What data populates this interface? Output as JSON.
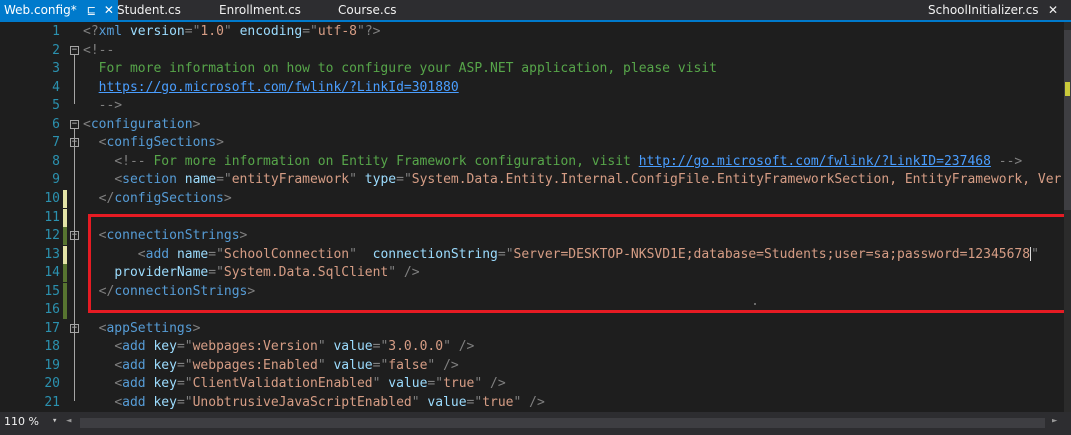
{
  "tabs": [
    {
      "label": "Web.config*",
      "active": true,
      "pin_icon": "pin-icon",
      "close_icon": "close-icon"
    },
    {
      "label": "Student.cs"
    },
    {
      "label": "Enrollment.cs"
    },
    {
      "label": "Course.cs"
    },
    {
      "label": "SchoolInitializer.cs",
      "close_icon": "close-icon"
    }
  ],
  "symbols": {
    "pin": "⊑",
    "close": "✕",
    "fold_open": "−",
    "dropdown": "▾",
    "left": "◄",
    "right": "►"
  },
  "colors": {
    "accent": "#007acc",
    "tag": "#569cd6",
    "attr": "#9cdcfe",
    "string": "#d69d85",
    "comment": "#57a64a",
    "line_number": "#2b91af",
    "highlight_box": "#e51b23"
  },
  "editor": {
    "lines": [
      {
        "num": "1",
        "tokens": [
          [
            "delim",
            "<?"
          ],
          [
            "tag",
            "xml"
          ],
          [
            "text",
            " "
          ],
          [
            "attr",
            "version"
          ],
          [
            "delim",
            "="
          ],
          [
            "delim",
            "\""
          ],
          [
            "str",
            "1.0"
          ],
          [
            "delim",
            "\""
          ],
          [
            "text",
            " "
          ],
          [
            "attr",
            "encoding"
          ],
          [
            "delim",
            "="
          ],
          [
            "delim",
            "\""
          ],
          [
            "str",
            "utf-8"
          ],
          [
            "delim",
            "\""
          ],
          [
            "delim",
            "?>"
          ]
        ]
      },
      {
        "num": "2",
        "tokens": [
          [
            "delim",
            "<!--"
          ]
        ]
      },
      {
        "num": "3",
        "tokens": [
          [
            "cmt",
            "  For more information on how to configure your ASP.NET application, please visit"
          ]
        ]
      },
      {
        "num": "4",
        "tokens": [
          [
            "cmt",
            "  "
          ],
          [
            "link",
            "https://go.microsoft.com/fwlink/?LinkId=301880"
          ]
        ]
      },
      {
        "num": "5",
        "tokens": [
          [
            "delim",
            "  -->"
          ]
        ]
      },
      {
        "num": "6",
        "tokens": [
          [
            "delim",
            "<"
          ],
          [
            "tag",
            "configuration"
          ],
          [
            "delim",
            ">"
          ]
        ]
      },
      {
        "num": "7",
        "tokens": [
          [
            "text",
            "  "
          ],
          [
            "delim",
            "<"
          ],
          [
            "tag",
            "configSections"
          ],
          [
            "delim",
            ">"
          ]
        ]
      },
      {
        "num": "8",
        "tokens": [
          [
            "text",
            "    "
          ],
          [
            "delim",
            "<!--"
          ],
          [
            "cmt",
            " For more information on Entity Framework configuration, visit "
          ],
          [
            "link",
            "http://go.microsoft.com/fwlink/?LinkID=237468"
          ],
          [
            "cmt",
            " "
          ],
          [
            "delim",
            "-->"
          ]
        ]
      },
      {
        "num": "9",
        "tokens": [
          [
            "text",
            "    "
          ],
          [
            "delim",
            "<"
          ],
          [
            "tag",
            "section"
          ],
          [
            "text",
            " "
          ],
          [
            "attr",
            "name"
          ],
          [
            "delim",
            "="
          ],
          [
            "delim",
            "\""
          ],
          [
            "str",
            "entityFramework"
          ],
          [
            "delim",
            "\""
          ],
          [
            "text",
            " "
          ],
          [
            "attr",
            "type"
          ],
          [
            "delim",
            "="
          ],
          [
            "delim",
            "\""
          ],
          [
            "str",
            "System.Data.Entity.Internal.ConfigFile.EntityFrameworkSection, EntityFramework, Ver"
          ]
        ]
      },
      {
        "num": "10",
        "tokens": [
          [
            "text",
            "  "
          ],
          [
            "delim",
            "</"
          ],
          [
            "tag",
            "configSections"
          ],
          [
            "delim",
            ">"
          ]
        ]
      },
      {
        "num": "11",
        "tokens": []
      },
      {
        "num": "12",
        "tokens": [
          [
            "text",
            "  "
          ],
          [
            "delim",
            "<"
          ],
          [
            "tag",
            "connectionStrings"
          ],
          [
            "delim",
            ">"
          ]
        ]
      },
      {
        "num": "13",
        "tokens": [
          [
            "text",
            "       "
          ],
          [
            "delim",
            "<"
          ],
          [
            "tag",
            "add"
          ],
          [
            "text",
            " "
          ],
          [
            "attr",
            "name"
          ],
          [
            "delim",
            "="
          ],
          [
            "delim",
            "\""
          ],
          [
            "str",
            "SchoolConnection"
          ],
          [
            "delim",
            "\""
          ],
          [
            "text",
            "  "
          ],
          [
            "attr",
            "connectionString"
          ],
          [
            "delim",
            "="
          ],
          [
            "delim",
            "\""
          ],
          [
            "str",
            "Server=DESKTOP-NKSVD1E;database=Students;user=sa;password=12345678"
          ],
          [
            "caret",
            ""
          ],
          [
            "delim",
            "\""
          ]
        ]
      },
      {
        "num": "14",
        "tokens": [
          [
            "text",
            "    "
          ],
          [
            "attr",
            "providerName"
          ],
          [
            "delim",
            "="
          ],
          [
            "delim",
            "\""
          ],
          [
            "str",
            "System.Data.SqlClient"
          ],
          [
            "delim",
            "\""
          ],
          [
            "text",
            " "
          ],
          [
            "delim",
            "/>"
          ]
        ]
      },
      {
        "num": "15",
        "tokens": [
          [
            "text",
            "  "
          ],
          [
            "delim",
            "</"
          ],
          [
            "tag",
            "connectionStrings"
          ],
          [
            "delim",
            ">"
          ]
        ]
      },
      {
        "num": "16",
        "tokens": []
      },
      {
        "num": "17",
        "tokens": [
          [
            "text",
            "  "
          ],
          [
            "delim",
            "<"
          ],
          [
            "tag",
            "appSettings"
          ],
          [
            "delim",
            ">"
          ]
        ]
      },
      {
        "num": "18",
        "tokens": [
          [
            "text",
            "    "
          ],
          [
            "delim",
            "<"
          ],
          [
            "tag",
            "add"
          ],
          [
            "text",
            " "
          ],
          [
            "attr",
            "key"
          ],
          [
            "delim",
            "="
          ],
          [
            "delim",
            "\""
          ],
          [
            "str",
            "webpages:Version"
          ],
          [
            "delim",
            "\""
          ],
          [
            "text",
            " "
          ],
          [
            "attr",
            "value"
          ],
          [
            "delim",
            "="
          ],
          [
            "delim",
            "\""
          ],
          [
            "str",
            "3.0.0.0"
          ],
          [
            "delim",
            "\""
          ],
          [
            "text",
            " "
          ],
          [
            "delim",
            "/>"
          ]
        ]
      },
      {
        "num": "19",
        "tokens": [
          [
            "text",
            "    "
          ],
          [
            "delim",
            "<"
          ],
          [
            "tag",
            "add"
          ],
          [
            "text",
            " "
          ],
          [
            "attr",
            "key"
          ],
          [
            "delim",
            "="
          ],
          [
            "delim",
            "\""
          ],
          [
            "str",
            "webpages:Enabled"
          ],
          [
            "delim",
            "\""
          ],
          [
            "text",
            " "
          ],
          [
            "attr",
            "value"
          ],
          [
            "delim",
            "="
          ],
          [
            "delim",
            "\""
          ],
          [
            "str",
            "false"
          ],
          [
            "delim",
            "\""
          ],
          [
            "text",
            " "
          ],
          [
            "delim",
            "/>"
          ]
        ]
      },
      {
        "num": "20",
        "tokens": [
          [
            "text",
            "    "
          ],
          [
            "delim",
            "<"
          ],
          [
            "tag",
            "add"
          ],
          [
            "text",
            " "
          ],
          [
            "attr",
            "key"
          ],
          [
            "delim",
            "="
          ],
          [
            "delim",
            "\""
          ],
          [
            "str",
            "ClientValidationEnabled"
          ],
          [
            "delim",
            "\""
          ],
          [
            "text",
            " "
          ],
          [
            "attr",
            "value"
          ],
          [
            "delim",
            "="
          ],
          [
            "delim",
            "\""
          ],
          [
            "str",
            "true"
          ],
          [
            "delim",
            "\""
          ],
          [
            "text",
            " "
          ],
          [
            "delim",
            "/>"
          ]
        ]
      },
      {
        "num": "21",
        "tokens": [
          [
            "text",
            "    "
          ],
          [
            "delim",
            "<"
          ],
          [
            "tag",
            "add"
          ],
          [
            "text",
            " "
          ],
          [
            "attr",
            "key"
          ],
          [
            "delim",
            "="
          ],
          [
            "delim",
            "\""
          ],
          [
            "str",
            "UnobtrusiveJavaScriptEnabled"
          ],
          [
            "delim",
            "\""
          ],
          [
            "text",
            " "
          ],
          [
            "attr",
            "value"
          ],
          [
            "delim",
            "="
          ],
          [
            "delim",
            "\""
          ],
          [
            "str",
            "true"
          ],
          [
            "delim",
            "\""
          ],
          [
            "text",
            " "
          ],
          [
            "delim",
            "/>"
          ]
        ]
      }
    ]
  },
  "statusbar": {
    "zoom": "110 %"
  }
}
